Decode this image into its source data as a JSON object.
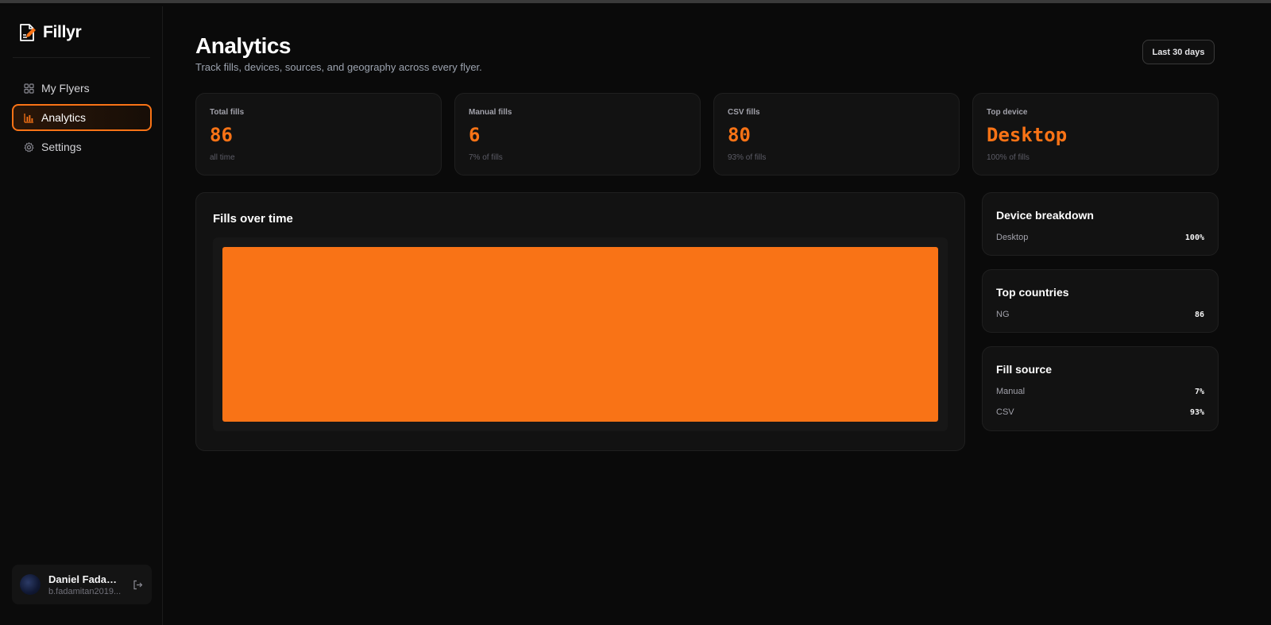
{
  "app": {
    "name": "Fillyr",
    "logo_icon": "flyer-pen-icon"
  },
  "sidebar": {
    "items": [
      {
        "label": "My Flyers",
        "icon": "grid-icon",
        "active": false
      },
      {
        "label": "Analytics",
        "icon": "bar-chart-icon",
        "active": true
      },
      {
        "label": "Settings",
        "icon": "gear-icon",
        "active": false
      }
    ],
    "user": {
      "name": "Daniel Fadamit...",
      "email": "b.fadamitan2019..."
    }
  },
  "header": {
    "title": "Analytics",
    "subtitle": "Track fills, devices, sources, and geography across every flyer.",
    "range_label": "Last 30 days"
  },
  "stats": [
    {
      "label": "Total fills",
      "value": "86",
      "sub": "all time"
    },
    {
      "label": "Manual fills",
      "value": "6",
      "sub": "7% of fills"
    },
    {
      "label": "CSV fills",
      "value": "80",
      "sub": "93% of fills"
    },
    {
      "label": "Top device",
      "value": "Desktop",
      "sub": "100% of fills"
    }
  ],
  "chart": {
    "title": "Fills over time"
  },
  "chart_data": {
    "type": "bar",
    "categories": [
      ""
    ],
    "values": [
      86
    ],
    "title": "Fills over time",
    "xlabel": "",
    "ylabel": "",
    "ylim": [
      0,
      86
    ],
    "grid": false,
    "color": "#f97316"
  },
  "device_breakdown": {
    "title": "Device breakdown",
    "rows": [
      {
        "label": "Desktop",
        "value": "100%"
      }
    ]
  },
  "top_countries": {
    "title": "Top countries",
    "rows": [
      {
        "label": "NG",
        "value": "86"
      }
    ]
  },
  "fill_source": {
    "title": "Fill source",
    "rows": [
      {
        "label": "Manual",
        "value": "7%"
      },
      {
        "label": "CSV",
        "value": "93%"
      }
    ]
  },
  "colors": {
    "accent": "#f97316",
    "background": "#0a0a0a",
    "card": "#121212"
  }
}
